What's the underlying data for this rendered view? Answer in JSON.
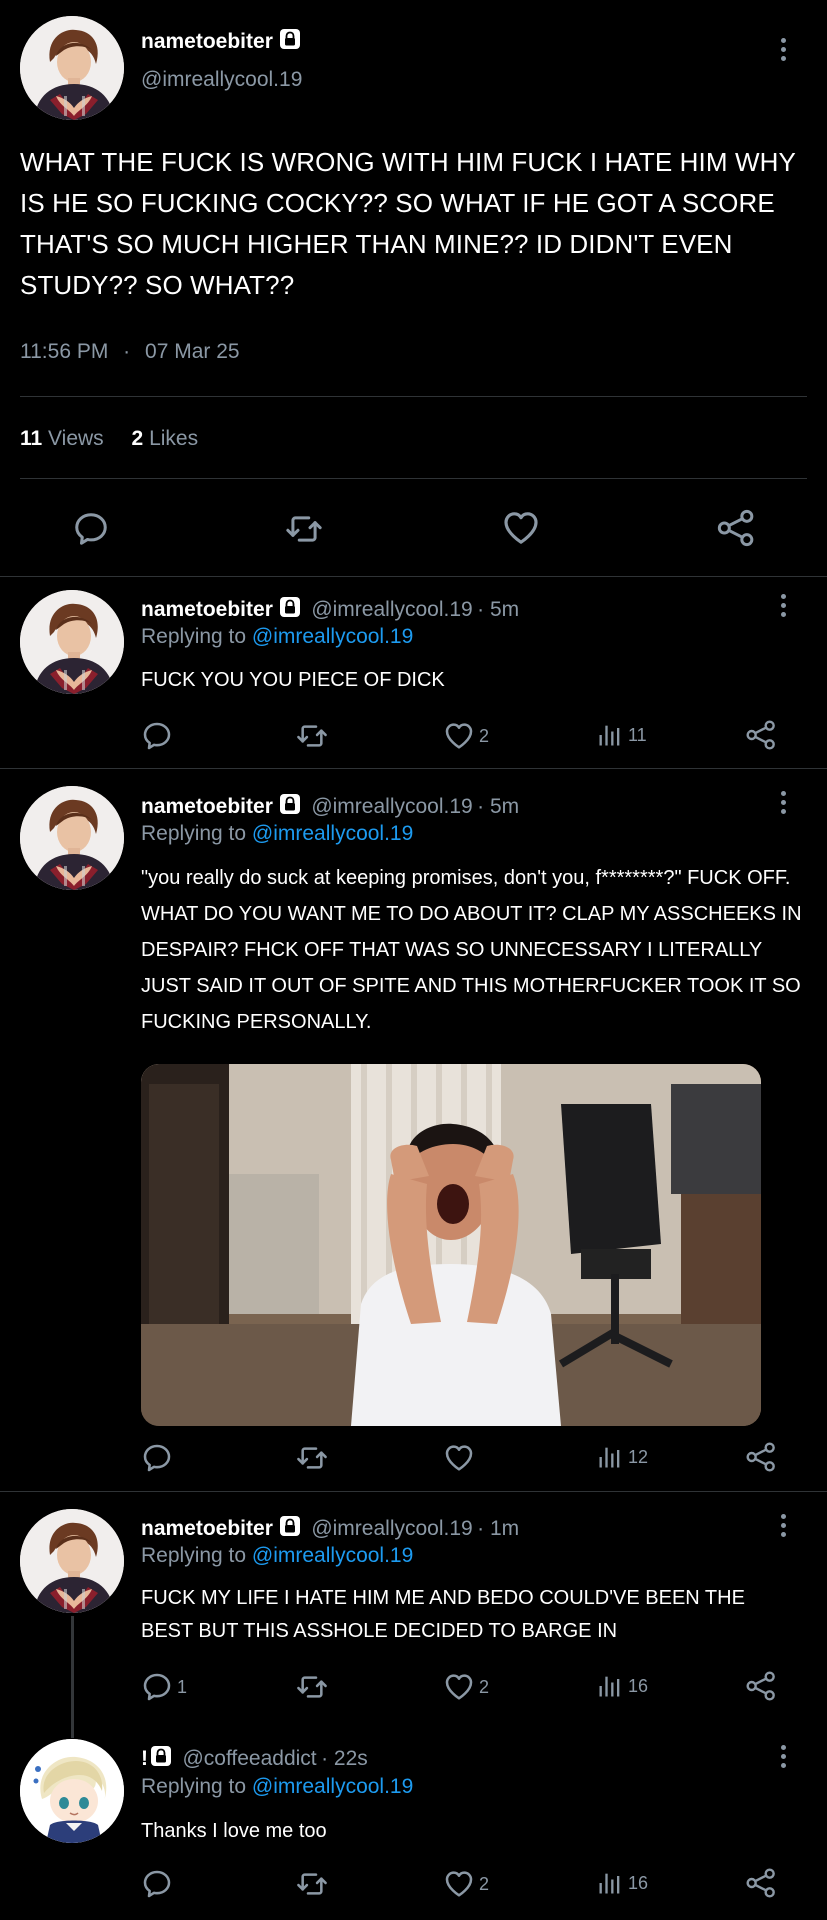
{
  "main_tweet": {
    "display_name": "nametoebiter",
    "handle": "@imreallycool.19",
    "text": "WHAT THE FUCK IS WRONG WITH HIM FUCK I HATE HIM WHY IS HE SO FUCKING COCKY?? SO WHAT IF HE GOT A SCORE THAT'S SO MUCH HIGHER THAN MINE?? ID DIDN'T EVEN STUDY?? SO WHAT??",
    "time": "11:56 PM",
    "dot": "·",
    "date": "07 Mar 25",
    "views_count": "11",
    "views_label": "Views",
    "likes_count": "2",
    "likes_label": "Likes"
  },
  "replies": [
    {
      "display_name": "nametoebiter",
      "handle": "@imreallycool.19",
      "time": "· 5m",
      "replying_label": "Replying to",
      "replying_to": "@imreallycool.19",
      "text": "FUCK YOU YOU PIECE OF DICK",
      "reply_count": "",
      "like_count": "2",
      "view_count": "11"
    },
    {
      "display_name": "nametoebiter",
      "handle": "@imreallycool.19",
      "time": "· 5m",
      "replying_label": "Replying to",
      "replying_to": "@imreallycool.19",
      "text": "\"you really do suck at keeping promises, don't you, f********?\" FUCK OFF. WHAT DO YOU WANT ME TO DO ABOUT IT? CLAP MY ASSCHEEKS IN DESPAIR? FHCK OFF THAT WAS SO UNNECESSARY I LITERALLY JUST SAID IT OUT OF SPITE AND THIS MOTHERFUCKER TOOK IT SO FUCKING PERSONALLY.",
      "reply_count": "",
      "like_count": "",
      "view_count": "12"
    },
    {
      "display_name": "nametoebiter",
      "handle": "@imreallycool.19",
      "time": "· 1m",
      "replying_label": "Replying to",
      "replying_to": "@imreallycool.19",
      "text": "FUCK MY LIFE I HATE HIM ME AND BEDO COULD'VE BEEN THE BEST BUT THIS ASSHOLE DECIDED TO BARGE IN",
      "reply_count": "1",
      "like_count": "2",
      "view_count": "16"
    },
    {
      "display_name": "!",
      "handle": "@coffeeaddict",
      "time": "· 22s",
      "replying_label": "Replying to",
      "replying_to": "@imreallycool.19",
      "text": "Thanks I love me too",
      "reply_count": "",
      "like_count": "2",
      "view_count": "16"
    }
  ],
  "icons": {
    "reply": "reply-icon",
    "retweet": "retweet-icon",
    "like": "heart-icon",
    "views": "views-icon",
    "share": "share-icon",
    "lock": "lock-icon",
    "more": "more-vertical-icon"
  },
  "colors": {
    "background": "#000000",
    "text": "#e7e9ea",
    "secondary": "#8b98a5",
    "link": "#1d9bf0",
    "divider": "#2f3336"
  }
}
